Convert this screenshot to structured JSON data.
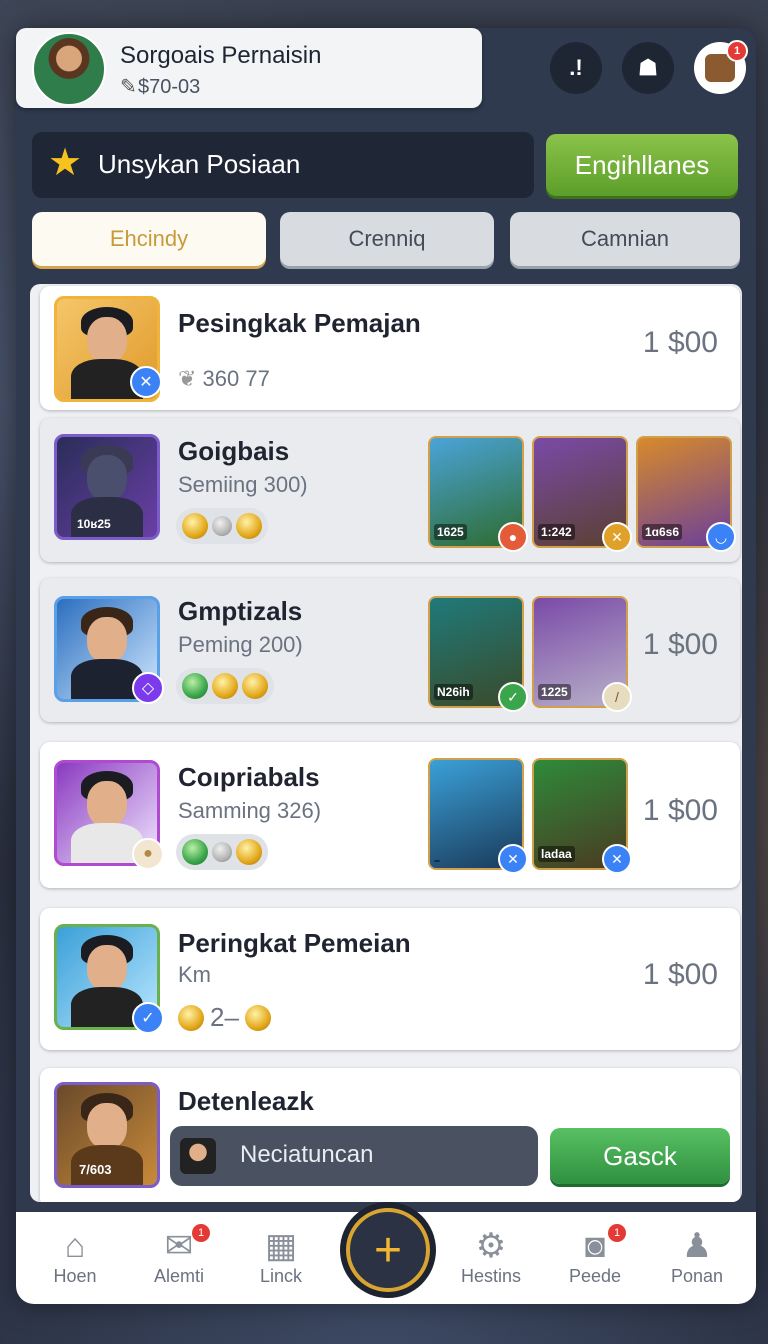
{
  "profile": {
    "name": "Sorgoais Pernaisin",
    "balance": "$70-03"
  },
  "top_actions": [
    {
      "glyph": ".!"
    },
    {
      "glyph": "☗"
    },
    {
      "glyph": "",
      "badge": "1"
    }
  ],
  "header": {
    "title": "Unsykan Posiaan",
    "action_label": "Engihllanes"
  },
  "tabs": [
    {
      "label": "Ehcindy",
      "active": true
    },
    {
      "label": "Crenniq"
    },
    {
      "label": "Camnian"
    }
  ],
  "rows": [
    {
      "title": "Pesingkak Pemajan",
      "subtitle": "360 77",
      "price": "1 $00"
    },
    {
      "title": "Goigbais",
      "subtitle": "Semiing 300)",
      "cards": [
        "1625",
        "1:242",
        "1ɑ6s6"
      ]
    },
    {
      "title": "Gmptizals",
      "subtitle": "Peming 200)",
      "price": "1 $00",
      "cards": [
        "N26ih",
        "1225"
      ]
    },
    {
      "title": "Coıpriabals",
      "subtitle": "Samming 326)",
      "price": "1 $00",
      "cards": [
        "",
        "ladaa"
      ]
    },
    {
      "title": "Peringkat Pemeian",
      "subtitle": "Km",
      "price": "1 $00",
      "coin_text": "2–"
    },
    {
      "title": "Detenleazk",
      "level": "7/603"
    }
  ],
  "first_row_level": "10ʁ25",
  "bottom_overlay": {
    "text": "Neciatuncan",
    "button_label": "Gasck"
  },
  "nav": [
    {
      "label": "Hoen",
      "icon": "home-icon"
    },
    {
      "label": "Alemti",
      "icon": "chat-icon",
      "badge": "1"
    },
    {
      "label": "Linck",
      "icon": "grid-icon"
    },
    {
      "label": "Hestins",
      "icon": "gear-icon"
    },
    {
      "label": "Peede",
      "icon": "camera-icon",
      "badge": "1"
    },
    {
      "label": "Ponan",
      "icon": "person-icon"
    }
  ],
  "plus_glyph": "+"
}
